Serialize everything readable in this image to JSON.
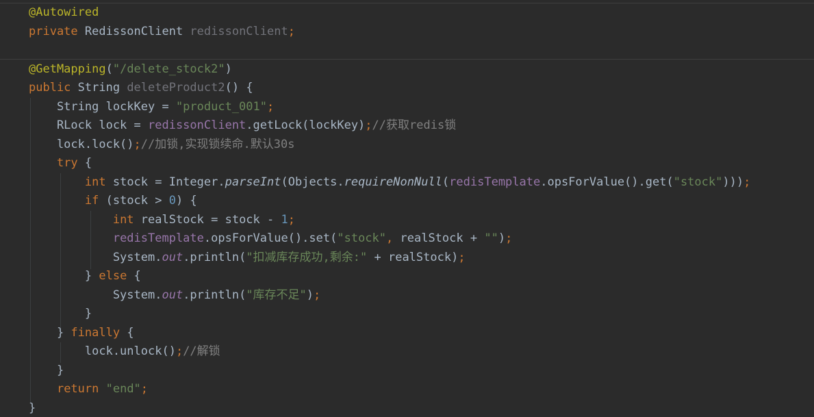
{
  "colors": {
    "background": "#2b2b2b",
    "keyword": "#cc7832",
    "annotation": "#bbb529",
    "string": "#6a8759",
    "number": "#6897bb",
    "field": "#9876aa",
    "unused": "#72737a",
    "comment": "#808080",
    "text": "#a9b7c6"
  },
  "code": {
    "lines": [
      {
        "tokens": [
          {
            "t": "@Autowired",
            "c": "ann"
          }
        ]
      },
      {
        "tokens": [
          {
            "t": "private ",
            "c": "kw"
          },
          {
            "t": "RedissonClient ",
            "c": "plain"
          },
          {
            "t": "redissonClient",
            "c": "unused"
          },
          {
            "t": ";",
            "c": "kw"
          }
        ]
      },
      {
        "tokens": []
      },
      {
        "tokens": [
          {
            "t": "@GetMapping",
            "c": "ann"
          },
          {
            "t": "(",
            "c": "plain"
          },
          {
            "t": "\"/delete_stock2\"",
            "c": "str"
          },
          {
            "t": ")",
            "c": "plain"
          }
        ]
      },
      {
        "tokens": [
          {
            "t": "public ",
            "c": "kw"
          },
          {
            "t": "String ",
            "c": "plain"
          },
          {
            "t": "deleteProduct2",
            "c": "unused"
          },
          {
            "t": "() {",
            "c": "plain"
          }
        ]
      },
      {
        "tokens": [
          {
            "t": "    String lockKey = ",
            "c": "plain"
          },
          {
            "t": "\"product_001\"",
            "c": "str"
          },
          {
            "t": ";",
            "c": "kw"
          }
        ]
      },
      {
        "tokens": [
          {
            "t": "    RLock lock = ",
            "c": "plain"
          },
          {
            "t": "redissonClient",
            "c": "fld"
          },
          {
            "t": ".getLock(lockKey)",
            "c": "plain"
          },
          {
            "t": ";",
            "c": "kw"
          },
          {
            "t": "//获取redis锁",
            "c": "cmt"
          }
        ]
      },
      {
        "tokens": [
          {
            "t": "    lock.lock()",
            "c": "plain"
          },
          {
            "t": ";",
            "c": "kw"
          },
          {
            "t": "//加锁,实现锁续命.默认30s",
            "c": "cmt"
          }
        ]
      },
      {
        "tokens": [
          {
            "t": "    ",
            "c": "plain"
          },
          {
            "t": "try ",
            "c": "kw"
          },
          {
            "t": "{",
            "c": "plain"
          }
        ]
      },
      {
        "tokens": [
          {
            "t": "        ",
            "c": "plain"
          },
          {
            "t": "int ",
            "c": "kw"
          },
          {
            "t": "stock = Integer.",
            "c": "plain"
          },
          {
            "t": "parseInt",
            "c": "plain it"
          },
          {
            "t": "(Objects.",
            "c": "plain"
          },
          {
            "t": "requireNonNull",
            "c": "plain it"
          },
          {
            "t": "(",
            "c": "plain"
          },
          {
            "t": "redisTemplate",
            "c": "fld"
          },
          {
            "t": ".opsForValue().get(",
            "c": "plain"
          },
          {
            "t": "\"stock\"",
            "c": "str"
          },
          {
            "t": ")))",
            "c": "plain"
          },
          {
            "t": ";",
            "c": "kw"
          }
        ]
      },
      {
        "tokens": [
          {
            "t": "        ",
            "c": "plain"
          },
          {
            "t": "if ",
            "c": "kw"
          },
          {
            "t": "(stock > ",
            "c": "plain"
          },
          {
            "t": "0",
            "c": "num"
          },
          {
            "t": ") {",
            "c": "plain"
          }
        ]
      },
      {
        "tokens": [
          {
            "t": "            ",
            "c": "plain"
          },
          {
            "t": "int ",
            "c": "kw"
          },
          {
            "t": "realStock = stock - ",
            "c": "plain"
          },
          {
            "t": "1",
            "c": "num"
          },
          {
            "t": ";",
            "c": "kw"
          }
        ]
      },
      {
        "tokens": [
          {
            "t": "            ",
            "c": "plain"
          },
          {
            "t": "redisTemplate",
            "c": "fld"
          },
          {
            "t": ".opsForValue().set(",
            "c": "plain"
          },
          {
            "t": "\"stock\"",
            "c": "str"
          },
          {
            "t": ", ",
            "c": "kw"
          },
          {
            "t": "realStock + ",
            "c": "plain"
          },
          {
            "t": "\"\"",
            "c": "str"
          },
          {
            "t": ")",
            "c": "plain"
          },
          {
            "t": ";",
            "c": "kw"
          }
        ]
      },
      {
        "tokens": [
          {
            "t": "            System.",
            "c": "plain"
          },
          {
            "t": "out",
            "c": "fld it"
          },
          {
            "t": ".println(",
            "c": "plain"
          },
          {
            "t": "\"扣减库存成功,剩余:\"",
            "c": "str"
          },
          {
            "t": " + realStock)",
            "c": "plain"
          },
          {
            "t": ";",
            "c": "kw"
          }
        ]
      },
      {
        "tokens": [
          {
            "t": "        } ",
            "c": "plain"
          },
          {
            "t": "else ",
            "c": "kw"
          },
          {
            "t": "{",
            "c": "plain"
          }
        ]
      },
      {
        "tokens": [
          {
            "t": "            System.",
            "c": "plain"
          },
          {
            "t": "out",
            "c": "fld it"
          },
          {
            "t": ".println(",
            "c": "plain"
          },
          {
            "t": "\"库存不足\"",
            "c": "str"
          },
          {
            "t": ")",
            "c": "plain"
          },
          {
            "t": ";",
            "c": "kw"
          }
        ]
      },
      {
        "tokens": [
          {
            "t": "        }",
            "c": "plain"
          }
        ]
      },
      {
        "tokens": [
          {
            "t": "    } ",
            "c": "plain"
          },
          {
            "t": "finally ",
            "c": "kw"
          },
          {
            "t": "{",
            "c": "plain"
          }
        ]
      },
      {
        "tokens": [
          {
            "t": "        lock.unlock()",
            "c": "plain"
          },
          {
            "t": ";",
            "c": "kw"
          },
          {
            "t": "//解锁",
            "c": "cmt"
          }
        ]
      },
      {
        "tokens": [
          {
            "t": "    }",
            "c": "plain"
          }
        ]
      },
      {
        "tokens": [
          {
            "t": "    ",
            "c": "plain"
          },
          {
            "t": "return ",
            "c": "kw"
          },
          {
            "t": "\"end\"",
            "c": "str"
          },
          {
            "t": ";",
            "c": "kw"
          }
        ]
      },
      {
        "tokens": [
          {
            "t": "}",
            "c": "plain"
          }
        ]
      }
    ]
  }
}
